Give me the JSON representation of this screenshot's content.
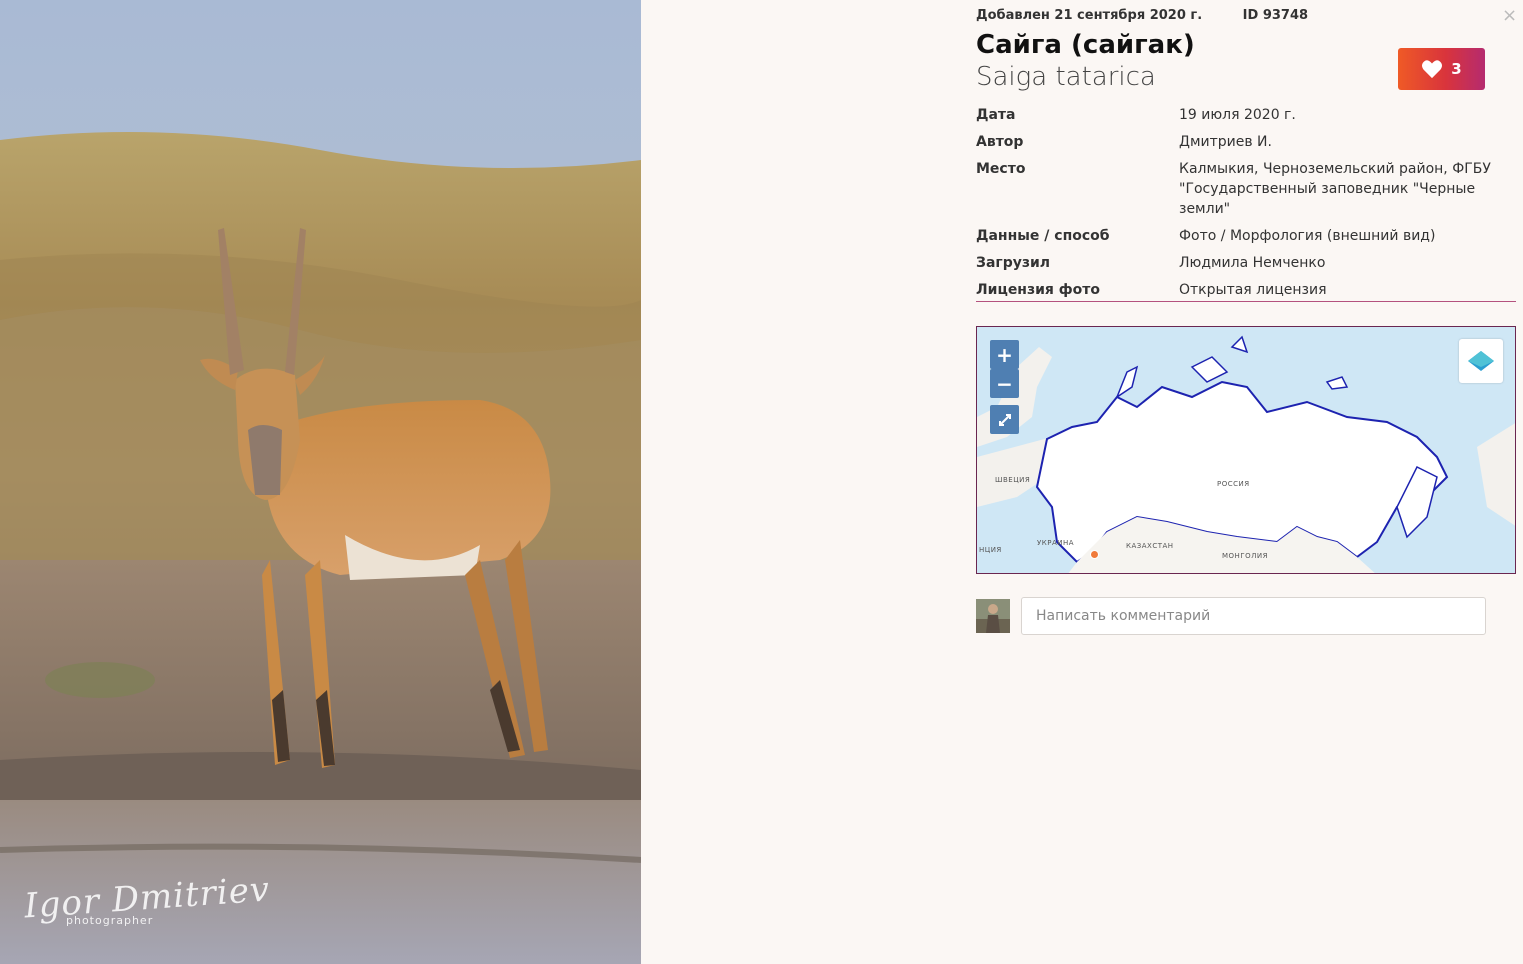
{
  "photo": {
    "watermark_name": "Igor Dmitriev",
    "watermark_role": "photographer"
  },
  "header": {
    "added": "Добавлен 21 сентября 2020 г.",
    "id_label": "ID 93748",
    "close_symbol": "×"
  },
  "species": {
    "name": "Сайга (сайгак)",
    "latin": "Saiga tatarica"
  },
  "likes": {
    "count": "3",
    "icon": "heart-icon"
  },
  "properties": [
    {
      "label": "Дата",
      "value": "19 июля 2020 г."
    },
    {
      "label": "Автор",
      "value": "Дмитриев И."
    },
    {
      "label": "Место",
      "value": "Калмыкия, Черноземельский район, ФГБУ \"Государственный заповедник \"Черные земли\""
    },
    {
      "label": "Данные / способ",
      "value": "Фото / Морфология (внешний вид)"
    },
    {
      "label": "Загрузил",
      "value": "Людмила Немченко"
    },
    {
      "label": "Лицензия фото",
      "value": "Открытая лицензия"
    }
  ],
  "map": {
    "zoom_in": "+",
    "zoom_out": "−",
    "fullscreen_icon": "expand-icon",
    "layers_icon": "layers-icon",
    "labels": {
      "russia": "РОССИЯ",
      "sweden": "ШВЕЦИЯ",
      "ukraine": "УКРАИНА",
      "kazakhstan": "КАЗАХСТАН",
      "mongolia": "МОНГОЛИЯ",
      "partial": "НЦИЯ"
    }
  },
  "comment": {
    "placeholder": "Написать комментарий"
  },
  "colors": {
    "accent": "#b4527e",
    "like_gradient_start": "#ef5a26",
    "like_gradient_end": "#b52b6f",
    "map_border": "#6a2650",
    "map_control": "#4f7fb2",
    "marker": "#f07a3a"
  }
}
